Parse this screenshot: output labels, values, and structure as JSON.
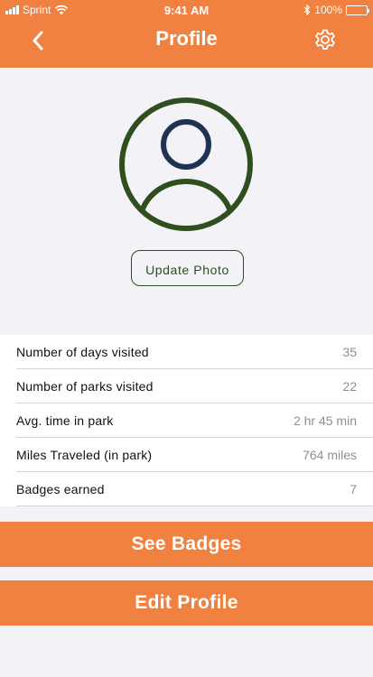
{
  "status_bar": {
    "carrier": "Sprint",
    "time": "9:41 AM",
    "battery": "100%",
    "icons": [
      "signal-icon",
      "wifi-icon",
      "bluetooth-icon",
      "battery-icon"
    ]
  },
  "nav": {
    "title": "Profile",
    "back_icon": "chevron-left-icon",
    "settings_icon": "gear-icon"
  },
  "profile": {
    "avatar_icon": "user-avatar-icon",
    "update_photo_label": "Update Photo"
  },
  "stats": [
    {
      "label": "Number of days visited",
      "value": "35"
    },
    {
      "label": "Number of parks visited",
      "value": "22"
    },
    {
      "label": "Avg. time in park",
      "value": "2 hr 45 min"
    },
    {
      "label": "Miles Traveled (in park)",
      "value": "764 miles"
    },
    {
      "label": "Badges earned",
      "value": "7"
    }
  ],
  "actions": {
    "see_badges_label": "See Badges",
    "edit_profile_label": "Edit Profile"
  },
  "colors": {
    "accent": "#f08140",
    "avatar_green": "#2f4f1f",
    "avatar_navy": "#1e3353",
    "background": "#f2f2f7"
  }
}
